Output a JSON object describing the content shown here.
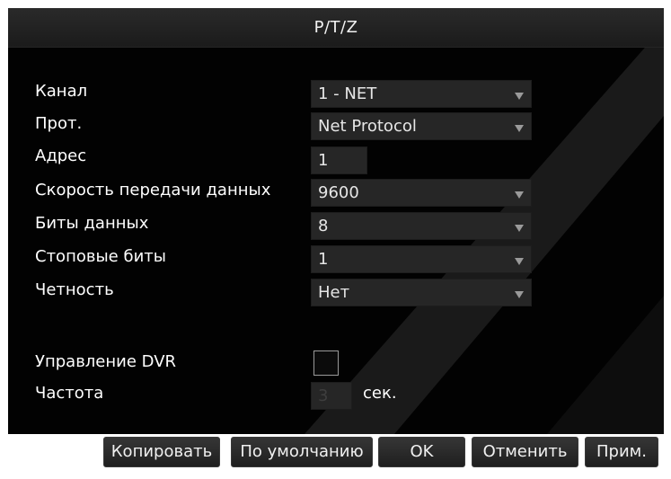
{
  "window": {
    "title": "P/T/Z"
  },
  "form": {
    "channel": {
      "label": "Канал",
      "value": "1 - NET"
    },
    "protocol": {
      "label": "Прот.",
      "value": "Net Protocol"
    },
    "address": {
      "label": "Адрес",
      "value": "1"
    },
    "baud_rate": {
      "label": "Скорость передачи данных",
      "value": "9600"
    },
    "data_bits": {
      "label": "Биты данных",
      "value": "8"
    },
    "stop_bits": {
      "label": "Стоповые биты",
      "value": "1"
    },
    "parity": {
      "label": "Четность",
      "value": "Нет"
    },
    "dvr_control": {
      "label": "Управление DVR",
      "checked": false
    },
    "frequency": {
      "label": "Частота",
      "value": "3",
      "unit": "сек."
    }
  },
  "buttons": {
    "copy": "Копировать",
    "default": "По умолчанию",
    "ok": "OK",
    "cancel": "Отменить",
    "apply": "Прим."
  },
  "colors": {
    "background": "#020202",
    "field": "#262626",
    "text": "#ffffff",
    "button": "#2a2a2a"
  }
}
